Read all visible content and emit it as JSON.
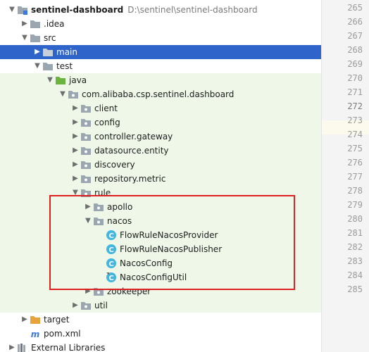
{
  "tree": {
    "root": {
      "label": "sentinel-dashboard",
      "path": "D:\\sentinel\\sentinel-dashboard"
    },
    "idea": "idea",
    "src": "src",
    "main": "main",
    "test": "test",
    "java": "java",
    "package": "com.alibaba.csp.sentinel.dashboard",
    "client": "client",
    "config": "config",
    "controller_gateway": "controller.gateway",
    "datasource_entity": "datasource.entity",
    "discovery": "discovery",
    "repository_metric": "repository.metric",
    "rule": "rule",
    "apollo": "apollo",
    "nacos": "nacos",
    "files": [
      "FlowRuleNacosProvider",
      "FlowRuleNacosPublisher",
      "NacosConfig",
      "NacosConfigUtil"
    ],
    "zookeeper": "zookeeper",
    "util": "util",
    "target": "target",
    "pom": "pom.xml",
    "external": "External Libraries"
  },
  "gutter": {
    "line_numbers": [
      "265",
      "266",
      "267",
      "268",
      "269",
      "270",
      "271",
      "272",
      "273",
      "274",
      "275",
      "276",
      "277",
      "278",
      "279",
      "280",
      "281",
      "282",
      "283",
      "284",
      "285"
    ],
    "current_line": "272"
  },
  "colors": {
    "selection": "#2f65ca",
    "test_scope_bg": "#eef7e8",
    "highlight_box": "#e02020",
    "folder": "#9aa7b0",
    "source_folder": "#6db33f",
    "class_icon": "#40b6e0"
  }
}
